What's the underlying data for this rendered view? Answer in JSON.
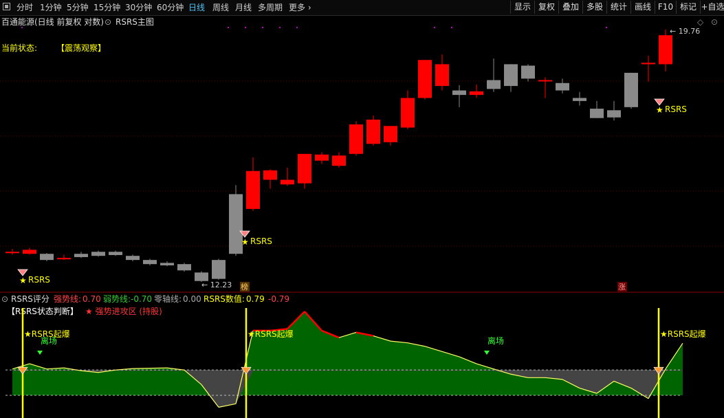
{
  "toolbar": {
    "periods": [
      "分时",
      "1分钟",
      "5分钟",
      "15分钟",
      "30分钟",
      "60分钟",
      "日线",
      "周线",
      "月线",
      "多周期",
      "更多"
    ],
    "active_period": "日线",
    "buttons": [
      "显示",
      "复权",
      "叠加",
      "多股",
      "统计",
      "画线",
      "F10",
      "标记",
      "+自选"
    ]
  },
  "main_panel": {
    "title": "百通能源(日线 前复权 对数)",
    "indicator": "RSRS主图",
    "status_label": "当前状态:",
    "status_value": "【震荡观察】",
    "price_high_label": "19.76",
    "price_low_label": "12.23",
    "badge_bang": "榜",
    "badge_zhang": "涨",
    "rsrs_label": "RSRS"
  },
  "sub_panel": {
    "name": "RSRS评分",
    "strong_label": "强势线:",
    "strong_value": "0.70",
    "weak_label": "弱势线:",
    "weak_value": "-0.70",
    "zero_label": "零轴线:",
    "zero_value": "0.00",
    "rsrs_value_label": "RSRS数值:",
    "rsrs_value": "0.79",
    "rsrs_change": "-0.79",
    "legend_state": "【RSRS状态判断】",
    "legend_attack": "★ 强势进攻区 (持股)",
    "signal_label": "★RSRS起爆",
    "exit_label": "离场"
  },
  "colors": {
    "up": "#ff0000",
    "down": "#8a8a8a",
    "gold": "#ffff00",
    "green_fill": "#006400",
    "gray_fill": "#444444"
  },
  "chart_data": [
    {
      "type": "candlestick",
      "title": "百通能源(日线 前复权 对数)",
      "scale": "log",
      "labels": {
        "high": 19.76,
        "low": 12.23
      },
      "candles": [
        {
          "o": 12.95,
          "h": 13.02,
          "l": 12.88,
          "c": 12.95
        },
        {
          "o": 12.9,
          "h": 13.05,
          "l": 12.88,
          "c": 13.0
        },
        {
          "o": 12.9,
          "h": 12.92,
          "l": 12.72,
          "c": 12.75
        },
        {
          "o": 12.8,
          "h": 12.88,
          "l": 12.75,
          "c": 12.8
        },
        {
          "o": 12.9,
          "h": 12.95,
          "l": 12.8,
          "c": 12.82
        },
        {
          "o": 12.95,
          "h": 12.98,
          "l": 12.83,
          "c": 12.85
        },
        {
          "o": 12.95,
          "h": 12.98,
          "l": 12.85,
          "c": 12.87
        },
        {
          "o": 12.85,
          "h": 12.88,
          "l": 12.72,
          "c": 12.75
        },
        {
          "o": 12.75,
          "h": 12.78,
          "l": 12.62,
          "c": 12.65
        },
        {
          "o": 12.68,
          "h": 12.72,
          "l": 12.6,
          "c": 12.62
        },
        {
          "o": 12.65,
          "h": 12.68,
          "l": 12.47,
          "c": 12.5
        },
        {
          "o": 12.45,
          "h": 12.48,
          "l": 12.23,
          "c": 12.25
        },
        {
          "o": 12.75,
          "h": 12.78,
          "l": 12.28,
          "c": 12.3
        },
        {
          "o": 14.45,
          "h": 14.7,
          "l": 12.85,
          "c": 12.9
        },
        {
          "o": 14.05,
          "h": 15.5,
          "l": 14.0,
          "c": 15.1
        },
        {
          "o": 14.85,
          "h": 15.15,
          "l": 14.6,
          "c": 15.12
        },
        {
          "o": 14.72,
          "h": 15.2,
          "l": 14.68,
          "c": 14.85
        },
        {
          "o": 14.75,
          "h": 15.6,
          "l": 14.6,
          "c": 15.6
        },
        {
          "o": 15.4,
          "h": 15.65,
          "l": 15.3,
          "c": 15.58
        },
        {
          "o": 15.25,
          "h": 15.65,
          "l": 15.2,
          "c": 15.55
        },
        {
          "o": 15.6,
          "h": 16.6,
          "l": 15.55,
          "c": 16.5
        },
        {
          "o": 15.9,
          "h": 16.78,
          "l": 15.85,
          "c": 16.65
        },
        {
          "o": 15.95,
          "h": 16.4,
          "l": 15.85,
          "c": 16.45
        },
        {
          "o": 16.4,
          "h": 17.6,
          "l": 16.35,
          "c": 17.35
        },
        {
          "o": 17.35,
          "h": 18.65,
          "l": 17.3,
          "c": 18.65
        },
        {
          "o": 17.75,
          "h": 18.85,
          "l": 17.6,
          "c": 18.5
        },
        {
          "o": 17.6,
          "h": 17.78,
          "l": 17.05,
          "c": 17.45
        },
        {
          "o": 17.45,
          "h": 17.8,
          "l": 17.35,
          "c": 17.57
        },
        {
          "o": 17.95,
          "h": 18.7,
          "l": 17.55,
          "c": 17.65
        },
        {
          "o": 18.5,
          "h": 18.5,
          "l": 17.55,
          "c": 17.75
        },
        {
          "o": 18.45,
          "h": 18.5,
          "l": 17.9,
          "c": 18.0
        },
        {
          "o": 17.95,
          "h": 18.05,
          "l": 17.35,
          "c": 17.95
        },
        {
          "o": 17.85,
          "h": 18.0,
          "l": 17.5,
          "c": 17.6
        },
        {
          "o": 17.35,
          "h": 17.55,
          "l": 17.1,
          "c": 17.25
        },
        {
          "o": 17.0,
          "h": 17.25,
          "l": 16.7,
          "c": 16.7
        },
        {
          "o": 16.95,
          "h": 17.25,
          "l": 16.62,
          "c": 16.72
        },
        {
          "o": 18.2,
          "h": 18.2,
          "l": 17.0,
          "c": 17.05
        },
        {
          "o": 18.5,
          "h": 18.8,
          "l": 17.9,
          "c": 18.55
        },
        {
          "o": 18.5,
          "h": 19.76,
          "l": 18.25,
          "c": 19.55
        }
      ],
      "signals": [
        "RSRS",
        "RSRS",
        "RSRS"
      ]
    },
    {
      "type": "area",
      "title": "RSRS评分",
      "lines": {
        "strong": 0.7,
        "weak": -0.7,
        "zero": 0.0
      },
      "series": [
        {
          "name": "RSRS数值",
          "values": [
            0.05,
            0.2,
            0.05,
            0.08,
            0.0,
            -0.05,
            0.02,
            0.06,
            0.07,
            0.08,
            0.02,
            -0.4,
            -1.05,
            -0.95,
            1.15,
            1.15,
            1.2,
            1.7,
            1.15,
            0.95,
            1.1,
            1.0,
            0.85,
            0.8,
            0.7,
            0.55,
            0.4,
            0.2,
            0.05,
            -0.1,
            -0.2,
            -0.2,
            -0.25,
            -0.5,
            -0.65,
            -0.3,
            -0.5,
            -0.8,
            0.05,
            0.79
          ]
        }
      ]
    }
  ]
}
